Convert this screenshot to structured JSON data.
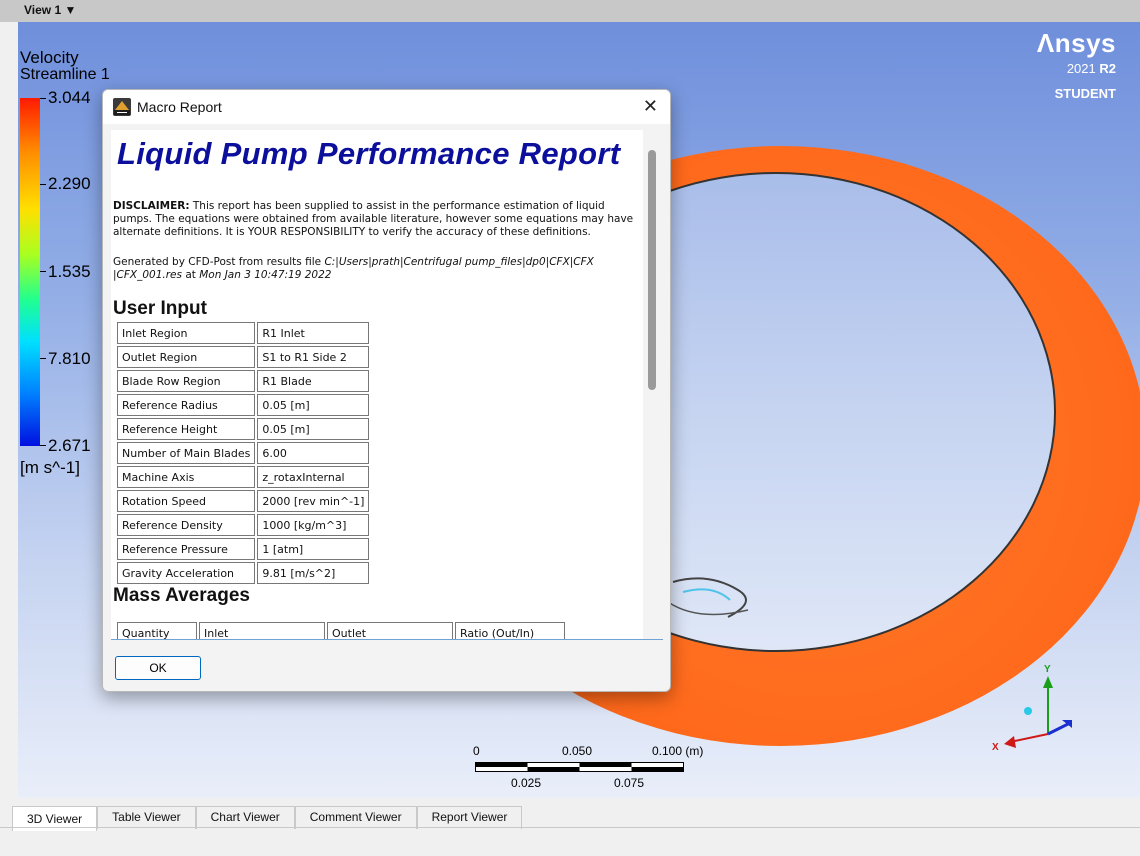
{
  "toolbar": {
    "view_label": "View 1 ▼"
  },
  "legend": {
    "variable": "Velocity",
    "object": "Streamline 1",
    "values": [
      "3.044",
      "2.290",
      "1.535",
      "7.810",
      "2.671"
    ],
    "unit": "[m s^-1]"
  },
  "brand": {
    "name": "Λnsys",
    "version_prefix": "2021 ",
    "version_bold": "R2",
    "edition": "STUDENT"
  },
  "scale": {
    "top_labels": [
      "0",
      "0.050",
      "0.100 (m)"
    ],
    "bottom_labels": [
      "0.025",
      "0.075"
    ]
  },
  "axes": {
    "x": "X",
    "y": "Y"
  },
  "tabs": [
    "3D Viewer",
    "Table Viewer",
    "Chart Viewer",
    "Comment Viewer",
    "Report Viewer"
  ],
  "dialog": {
    "title": "Macro Report",
    "close": "✕",
    "ok_label": "OK",
    "report": {
      "title": "Liquid Pump Performance Report",
      "disclaimer_label": "DISCLAIMER:",
      "disclaimer_text": " This report has been supplied to assist in the performance estimation of liquid pumps.  The equations were obtained from available literature, however some equations may have alternate definitions. It is YOUR RESPONSIBILITY to verify the accuracy of these definitions.",
      "generated_prefix": "Generated by CFD-Post from results file ",
      "generated_file": "C:|Users|prath|Centrifugal pump_files|dp0|CFX|CFX |CFX_001.res",
      "generated_mid": " at ",
      "generated_date": "Mon Jan 3 10:47:19 2022",
      "user_input_heading": "User Input",
      "user_input": [
        [
          "Inlet Region",
          "R1 Inlet"
        ],
        [
          "Outlet Region",
          "S1 to R1 Side 2"
        ],
        [
          "Blade Row Region",
          "R1 Blade"
        ],
        [
          "Reference Radius",
          "0.05 [m]"
        ],
        [
          "Reference Height",
          "0.05 [m]"
        ],
        [
          "Number of Main Blades",
          "6.00"
        ],
        [
          "Machine Axis",
          "z_rotaxInternal"
        ],
        [
          "Rotation Speed",
          "2000 [rev min^-1]"
        ],
        [
          "Reference Density",
          "1000 [kg/m^3]"
        ],
        [
          "Reference Pressure",
          "1 [atm]"
        ],
        [
          "Gravity Acceleration",
          "9.81 [m/s^2]"
        ]
      ],
      "mass_avg_heading": "Mass Averages",
      "mass_avg_headers": [
        "Quantity",
        "Inlet",
        "Outlet",
        "Ratio (Out/In)"
      ]
    }
  }
}
